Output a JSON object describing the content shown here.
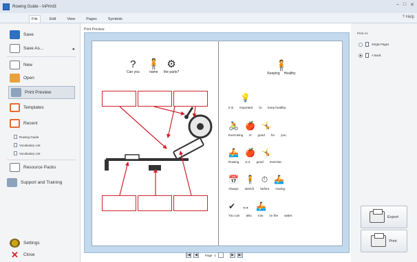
{
  "window": {
    "title": "Rowing Guide - InPrint3",
    "controls": [
      "–",
      "□",
      "✕"
    ]
  },
  "ribbon": {
    "tabs": [
      {
        "label": "File",
        "active": true
      },
      {
        "label": "Edit"
      },
      {
        "label": "View"
      },
      {
        "label": "Pages"
      },
      {
        "label": "Symbols"
      }
    ],
    "help": "? Help"
  },
  "sidebar": {
    "save": "Save",
    "save_as": "Save As...",
    "save_as_arrow": "▸",
    "new": "New",
    "open": "Open",
    "print_preview": "Print Preview",
    "templates": "Templates",
    "recent": "Recent",
    "recent_files": [
      "Rowing Guide",
      "Vocabulary List",
      "Vocabulary List"
    ],
    "resource_packs": "Resource Packs",
    "support": "Support and Training",
    "settings": "Settings",
    "close": "Close"
  },
  "preview": {
    "label": "Print Preview"
  },
  "left_page": {
    "question_words": [
      "Can you",
      "name",
      "the parts?"
    ],
    "question_glyphs": [
      "?",
      "🧍",
      "⚙"
    ]
  },
  "right_page": {
    "title_words": [
      "Keeping",
      "Healthy"
    ],
    "lines": [
      {
        "words": [
          "It is",
          "important",
          "to",
          "keep healthy."
        ],
        "glyphs": [
          "💡"
        ]
      },
      {
        "words": [
          "Exercising",
          "is",
          "good",
          "for",
          "you."
        ],
        "glyphs": [
          "🚴",
          "🍎",
          "🤸"
        ]
      },
      {
        "words": [
          "Rowing",
          "is a",
          "good",
          "exercise."
        ],
        "glyphs": [
          "🚣",
          "🍎",
          "🤸"
        ]
      },
      {
        "words": [
          "Always",
          "stretch",
          "before",
          "rowing."
        ],
        "glyphs": [
          "📅",
          "🧍",
          "⏱",
          "🚣"
        ]
      },
      {
        "words": [
          "You can",
          "also",
          "row",
          "on the",
          "water."
        ],
        "glyphs": [
          "✔",
          "↔",
          "🚣"
        ]
      }
    ]
  },
  "pager": {
    "page_label": "Page",
    "page_value": "1",
    "buttons": [
      "|◀",
      "◀",
      "▶",
      "▶|"
    ]
  },
  "layout_panel": {
    "label": "Print As",
    "options": [
      {
        "label": "Single Pages",
        "selected": false
      },
      {
        "label": "A Book",
        "selected": true
      }
    ]
  },
  "actions": {
    "export": "Export",
    "print": "Print"
  }
}
